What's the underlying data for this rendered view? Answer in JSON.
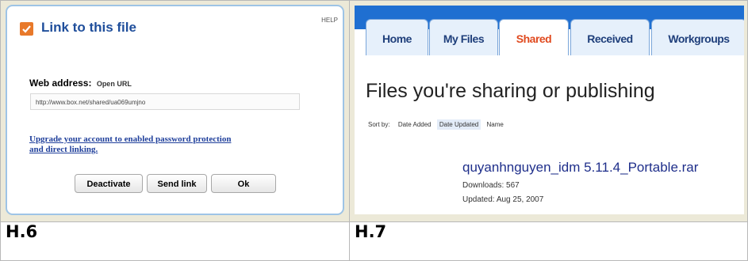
{
  "h6": {
    "title": "Link to this file",
    "help": "HELP",
    "web_address_label": "Web address:",
    "open_url": "Open URL",
    "url_value": "http://www.box.net/shared/ua069umjno",
    "upgrade_line1": "Upgrade your account to enabled password protection",
    "upgrade_line2": "and direct linking.",
    "buttons": {
      "deactivate": "Deactivate",
      "send_link": "Send link",
      "ok": "Ok"
    },
    "caption": "H.6",
    "accent": "#e8792a"
  },
  "h7": {
    "tabs": [
      "Home",
      "My Files",
      "Shared",
      "Received",
      "Workgroups"
    ],
    "active_tab": "Shared",
    "title": "Files you're sharing or publishing",
    "sort_label": "Sort by:",
    "sort_options": [
      "Date Added",
      "Date Updated",
      "Name"
    ],
    "file_name": "quyanhnguyen_idm 5.11.4_Portable.rar",
    "downloads": "Downloads: 567",
    "updated": "Updated: Aug 25, 2007",
    "caption": "H.7",
    "accent": "#e04a1f"
  }
}
